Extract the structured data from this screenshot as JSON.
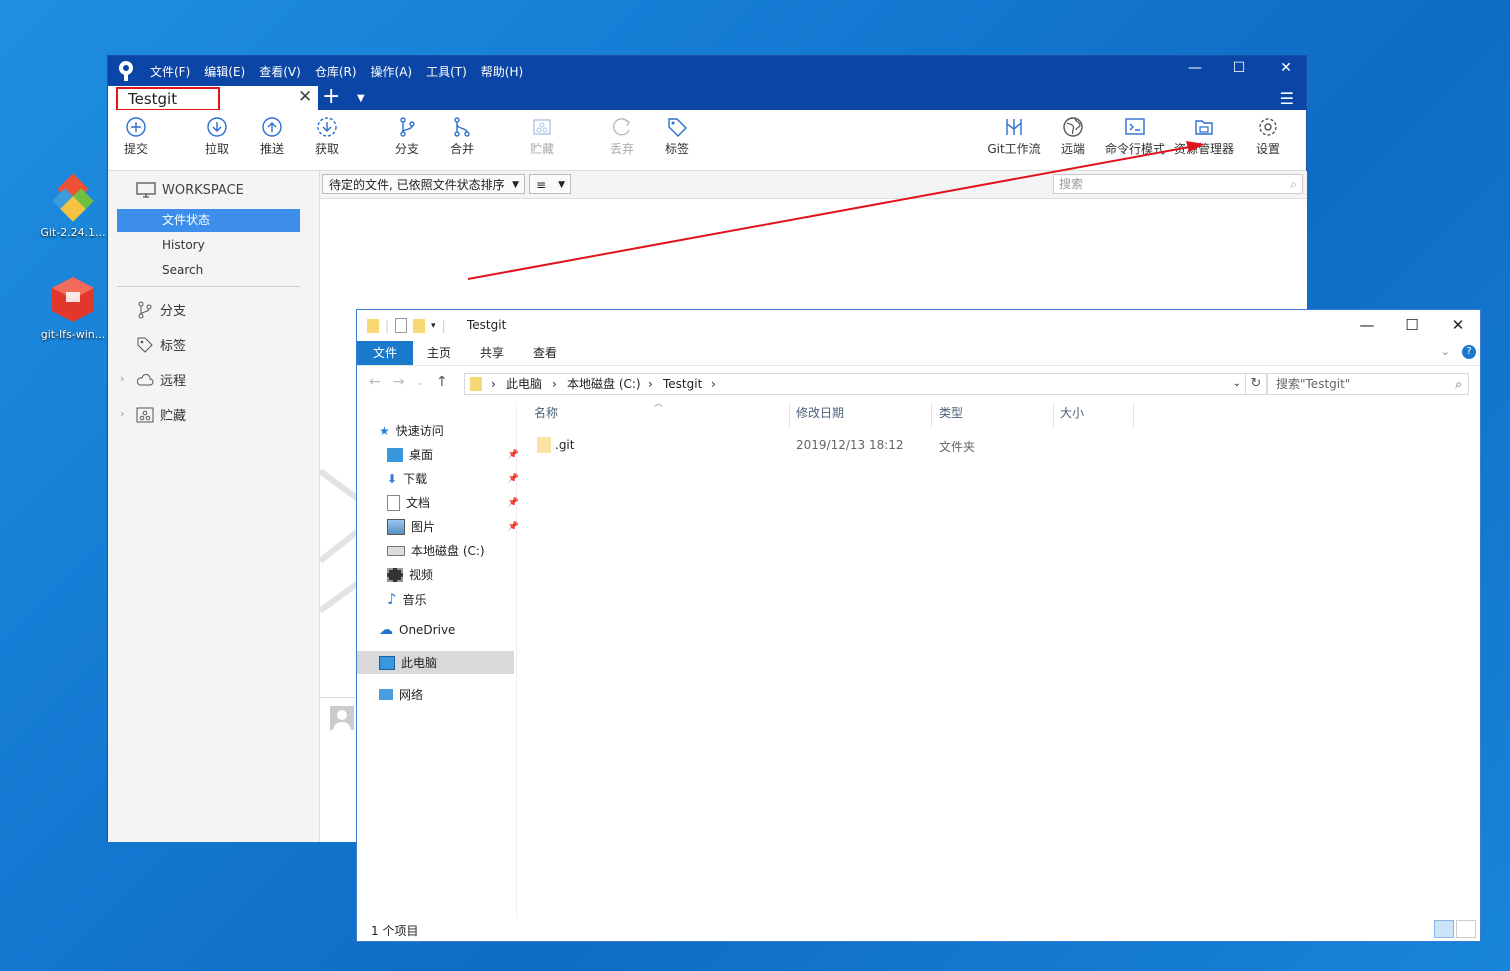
{
  "desktop": {
    "icons": [
      {
        "label": "Git-2.24.1..."
      },
      {
        "label": "git-lfs-win..."
      }
    ]
  },
  "sourcetree": {
    "menu": [
      "文件(F)",
      "编辑(E)",
      "查看(V)",
      "仓库(R)",
      "操作(A)",
      "工具(T)",
      "帮助(H)"
    ],
    "tab_name": "Testgit",
    "toolbar": {
      "commit": "提交",
      "pull": "拉取",
      "push": "推送",
      "fetch": "获取",
      "branch": "分支",
      "merge": "合并",
      "stash": "贮藏",
      "discard": "丢弃",
      "tag": "标签",
      "gitflow": "Git工作流",
      "remote": "远端",
      "terminal": "命令行模式",
      "explorer": "资源管理器",
      "settings": "设置"
    },
    "sidebar": {
      "workspace": "WORKSPACE",
      "items": [
        "文件状态",
        "History",
        "Search"
      ],
      "sections": [
        "分支",
        "标签",
        "远程",
        "贮藏"
      ]
    },
    "filter": {
      "sort_label": "待定的文件, 已依照文件状态排序",
      "view_label": "≡",
      "search_placeholder": "搜索"
    }
  },
  "explorer": {
    "title": "Testgit",
    "ribbon_tabs": [
      "文件",
      "主页",
      "共享",
      "查看"
    ],
    "breadcrumb": [
      "此电脑",
      "本地磁盘 (C:)",
      "Testgit"
    ],
    "search_placeholder": "搜索\"Testgit\"",
    "nav": {
      "quick_access": "快速访问",
      "quick_items": [
        "桌面",
        "下载",
        "文档",
        "图片",
        "本地磁盘 (C:)",
        "视频",
        "音乐"
      ],
      "onedrive": "OneDrive",
      "this_pc": "此电脑",
      "network": "网络"
    },
    "columns": [
      "名称",
      "修改日期",
      "类型",
      "大小"
    ],
    "rows": [
      {
        "name": ".git",
        "modified": "2019/12/13 18:12",
        "type": "文件夹",
        "size": ""
      }
    ],
    "status": "1 个项目"
  },
  "colors": {
    "sourcetree_title": "#0b46a6",
    "selection": "#3d8eeb",
    "annotation": "#e0141c",
    "explorer_file_tab": "#1979ca"
  }
}
